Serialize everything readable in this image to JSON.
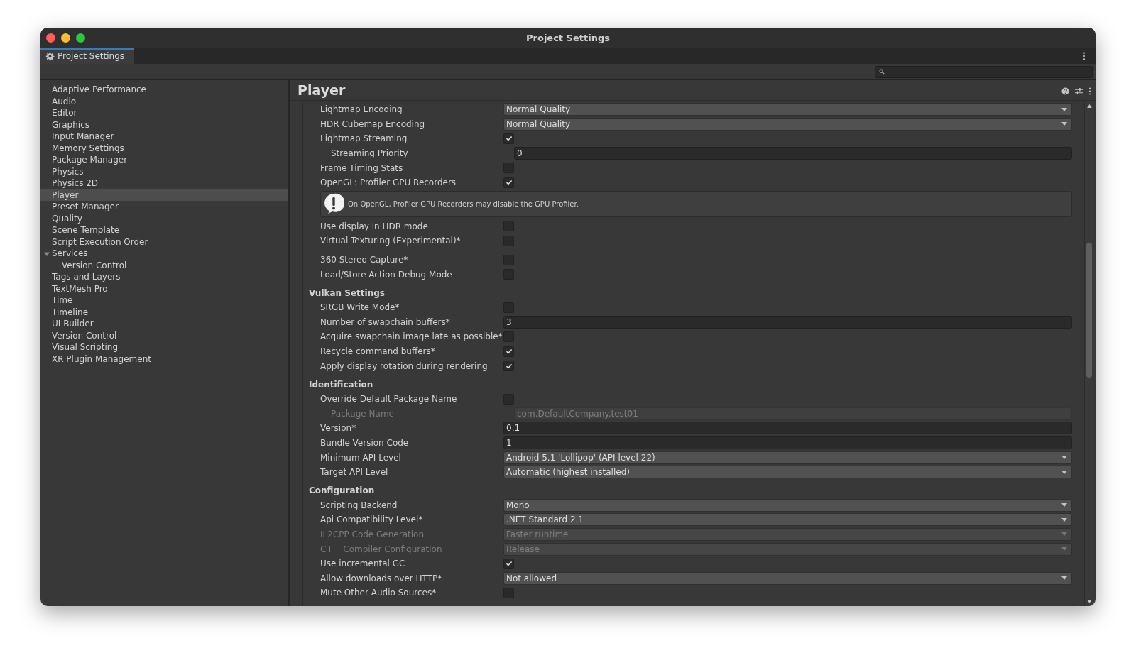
{
  "window": {
    "title": "Project Settings"
  },
  "tab": {
    "label": "Project Settings",
    "selected": true
  },
  "sidebar": {
    "items": [
      {
        "label": "Adaptive Performance",
        "selected": false
      },
      {
        "label": "Audio",
        "selected": false
      },
      {
        "label": "Editor",
        "selected": false
      },
      {
        "label": "Graphics",
        "selected": false
      },
      {
        "label": "Input Manager",
        "selected": false
      },
      {
        "label": "Memory Settings",
        "selected": false
      },
      {
        "label": "Package Manager",
        "selected": false
      },
      {
        "label": "Physics",
        "selected": false
      },
      {
        "label": "Physics 2D",
        "selected": false
      },
      {
        "label": "Player",
        "selected": true
      },
      {
        "label": "Preset Manager",
        "selected": false
      },
      {
        "label": "Quality",
        "selected": false
      },
      {
        "label": "Scene Template",
        "selected": false
      },
      {
        "label": "Script Execution Order",
        "selected": false
      },
      {
        "label": "Services",
        "selected": false,
        "expanded": true,
        "children": [
          {
            "label": "Version Control",
            "selected": false
          }
        ]
      },
      {
        "label": "Tags and Layers",
        "selected": false
      },
      {
        "label": "TextMesh Pro",
        "selected": false
      },
      {
        "label": "Time",
        "selected": false
      },
      {
        "label": "Timeline",
        "selected": false
      },
      {
        "label": "UI Builder",
        "selected": false
      },
      {
        "label": "Version Control",
        "selected": false
      },
      {
        "label": "Visual Scripting",
        "selected": false
      },
      {
        "label": "XR Plugin Management",
        "selected": false
      }
    ]
  },
  "panel": {
    "title": "Player",
    "sections": [
      {
        "rows": [
          {
            "kind": "dropdown",
            "label": "Lightmap Encoding",
            "value": "Normal Quality",
            "disabled": false
          },
          {
            "kind": "dropdown",
            "label": "HDR Cubemap Encoding",
            "value": "Normal Quality",
            "disabled": false
          },
          {
            "kind": "checkbox",
            "label": "Lightmap Streaming",
            "checked": true,
            "children": [
              {
                "kind": "text",
                "label": "Streaming Priority",
                "value": "0",
                "disabled": false
              }
            ]
          },
          {
            "kind": "checkbox",
            "label": "Frame Timing Stats",
            "checked": false
          },
          {
            "kind": "checkbox",
            "label": "OpenGL: Profiler GPU Recorders",
            "checked": true
          },
          {
            "kind": "info",
            "text": "On OpenGL, Profiler GPU Recorders may disable the GPU Profiler."
          },
          {
            "kind": "checkbox",
            "label": "Use display in HDR mode",
            "checked": false
          },
          {
            "kind": "checkbox",
            "label": "Virtual Texturing (Experimental)*",
            "checked": false
          }
        ]
      },
      {
        "rows": [
          {
            "kind": "checkbox",
            "label": "360 Stereo Capture*",
            "checked": false
          },
          {
            "kind": "checkbox",
            "label": "Load/Store Action Debug Mode",
            "checked": false
          }
        ]
      },
      {
        "title": "Vulkan Settings",
        "rows": [
          {
            "kind": "checkbox",
            "label": "SRGB Write Mode*",
            "checked": false
          },
          {
            "kind": "text",
            "label": "Number of swapchain buffers*",
            "value": "3",
            "disabled": false
          },
          {
            "kind": "checkbox",
            "label": "Acquire swapchain image late as possible*",
            "checked": false
          },
          {
            "kind": "checkbox",
            "label": "Recycle command buffers*",
            "checked": true
          },
          {
            "kind": "checkbox",
            "label": "Apply display rotation during rendering",
            "checked": true
          }
        ]
      },
      {
        "title": "Identification",
        "rows": [
          {
            "kind": "checkbox",
            "label": "Override Default Package Name",
            "checked": false,
            "children": [
              {
                "kind": "text",
                "label": "Package Name",
                "value": "com.DefaultCompany.test01",
                "disabled": true
              }
            ]
          },
          {
            "kind": "text",
            "label": "Version*",
            "value": "0.1",
            "disabled": false
          },
          {
            "kind": "text",
            "label": "Bundle Version Code",
            "value": "1",
            "disabled": false
          },
          {
            "kind": "dropdown",
            "label": "Minimum API Level",
            "value": "Android 5.1 'Lollipop' (API level 22)",
            "disabled": false
          },
          {
            "kind": "dropdown",
            "label": "Target API Level",
            "value": "Automatic (highest installed)",
            "disabled": false
          }
        ]
      },
      {
        "title": "Configuration",
        "rows": [
          {
            "kind": "dropdown",
            "label": "Scripting Backend",
            "value": "Mono",
            "disabled": false
          },
          {
            "kind": "dropdown",
            "label": "Api Compatibility Level*",
            "value": ".NET Standard 2.1",
            "disabled": false
          },
          {
            "kind": "dropdown",
            "label": "IL2CPP Code Generation",
            "value": "Faster runtime",
            "disabled": true
          },
          {
            "kind": "dropdown",
            "label": "C++ Compiler Configuration",
            "value": "Release",
            "disabled": true
          },
          {
            "kind": "checkbox",
            "label": "Use incremental GC",
            "checked": true
          },
          {
            "kind": "dropdown",
            "label": "Allow downloads over HTTP*",
            "value": "Not allowed",
            "disabled": false
          },
          {
            "kind": "checkbox",
            "label": "Mute Other Audio Sources*",
            "checked": false
          }
        ]
      }
    ]
  }
}
